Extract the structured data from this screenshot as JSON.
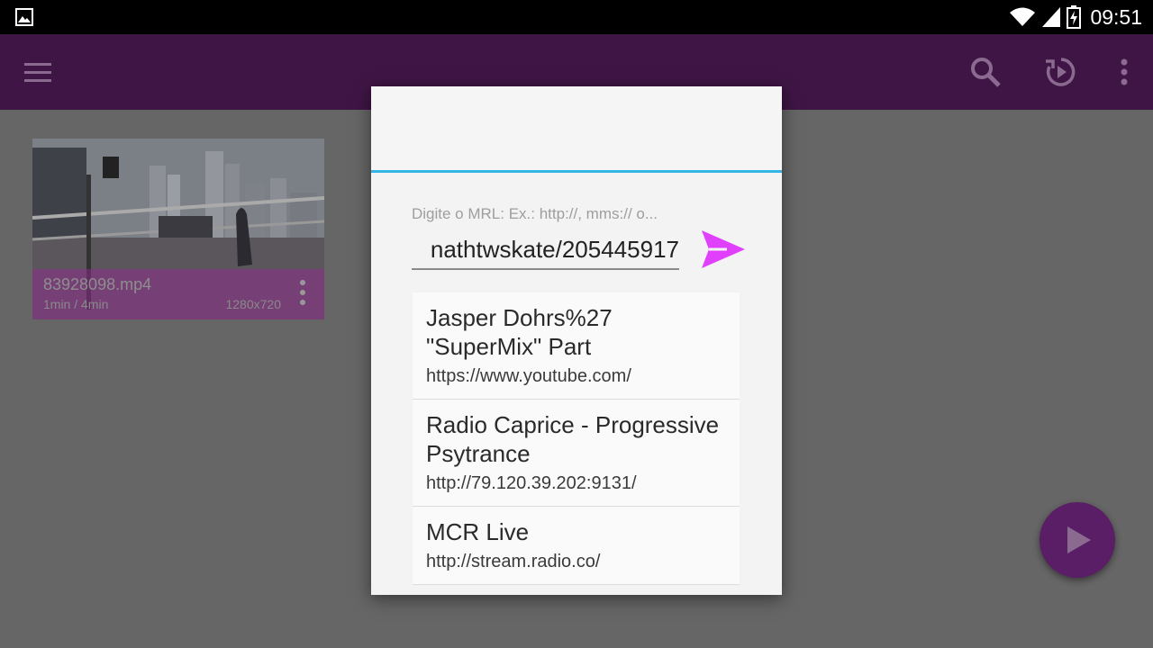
{
  "status_bar": {
    "time": "09:51",
    "icons": [
      "gallery-notification-icon",
      "wifi-icon",
      "signal-icon",
      "battery-charging-icon"
    ]
  },
  "app_bar": {
    "icons": [
      "menu-icon",
      "search-icon",
      "history-icon",
      "overflow-menu-icon"
    ],
    "color": "#3f1545"
  },
  "video": {
    "title": "83928098.mp4",
    "duration": "1min / 4min",
    "resolution": "1280x720",
    "progress_fraction": 0.25
  },
  "dialog": {
    "hint": "Digite o MRL: Ex.: http://, mms:// o...",
    "input_value": "nathtwskate/205445917",
    "accent": "#33b5e5",
    "send_color": "#e040fb",
    "history": [
      {
        "name": "Jasper Dohrs%27 \"SuperMix\" Part",
        "url": "https://www.youtube.com/"
      },
      {
        "name": "Radio Caprice - Progressive Psytrance",
        "url": "http://79.120.39.202:9131/"
      },
      {
        "name": "MCR Live",
        "url": "http://stream.radio.co/"
      }
    ]
  },
  "fab": {
    "icon": "play-icon",
    "color": "#5a1e66"
  }
}
